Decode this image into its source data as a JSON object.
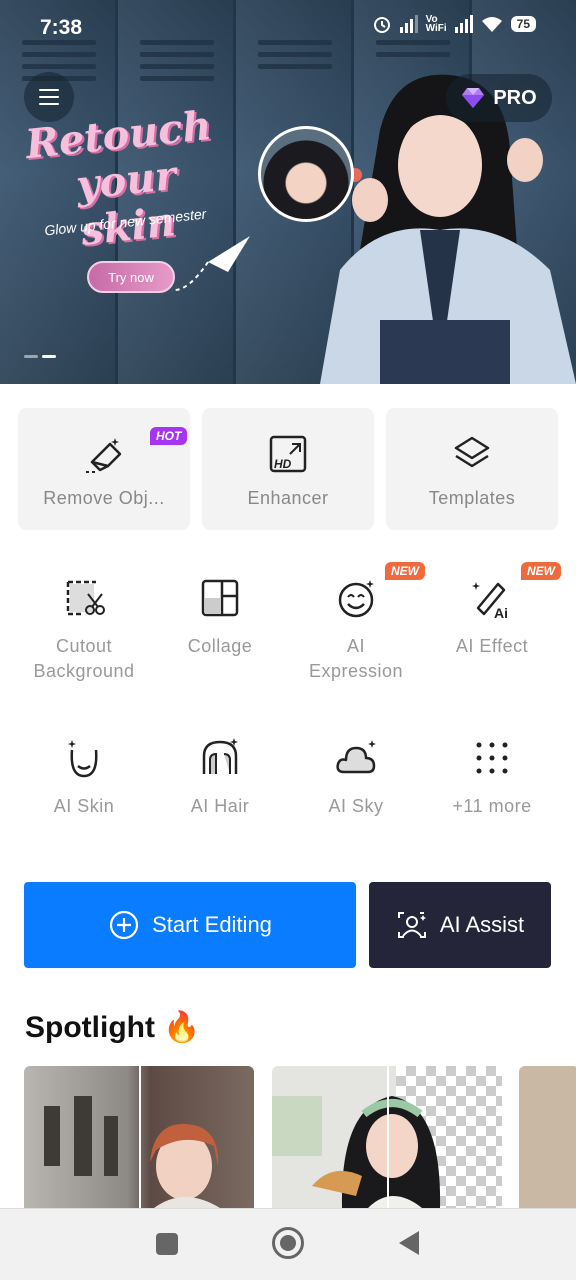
{
  "status_bar": {
    "time": "7:38",
    "vowifi_line1": "Vo",
    "vowifi_line2": "WiFi",
    "battery": "75"
  },
  "banner": {
    "headline_line1": "Retouch",
    "headline_line2": "your skin",
    "subline": "Glow up for new semester",
    "cta_label": "Try now",
    "pro_label": "PRO",
    "page_indicator": {
      "count": 2,
      "active": 1
    }
  },
  "feature_cards": [
    {
      "label": "Remove Obj...",
      "badge": "HOT",
      "icon": "eraser-icon"
    },
    {
      "label": "Enhancer",
      "icon": "hd-icon"
    },
    {
      "label": "Templates",
      "icon": "layers-icon"
    }
  ],
  "tools_row1": [
    {
      "label": "Cutout Background",
      "icon": "cutout-icon"
    },
    {
      "label": "Collage",
      "icon": "collage-icon"
    },
    {
      "label": "AI Expression",
      "badge": "NEW",
      "icon": "smiley-icon"
    },
    {
      "label": "AI Effect",
      "badge": "NEW",
      "icon": "ai-effect-icon"
    }
  ],
  "tools_row2": [
    {
      "label": "AI Skin",
      "icon": "face-icon"
    },
    {
      "label": "AI Hair",
      "icon": "hair-icon"
    },
    {
      "label": "AI Sky",
      "icon": "cloud-icon"
    },
    {
      "label": "+11 more",
      "icon": "grid-dots-icon"
    }
  ],
  "actions": {
    "start_editing": "Start Editing",
    "ai_assist": "AI Assist"
  },
  "spotlight": {
    "title": "Spotlight",
    "emoji": "🔥"
  },
  "colors": {
    "primary": "#0a7cff",
    "dark_button": "#25253a",
    "hot_badge": "#a535f0",
    "new_badge": "#ef6a3d"
  }
}
